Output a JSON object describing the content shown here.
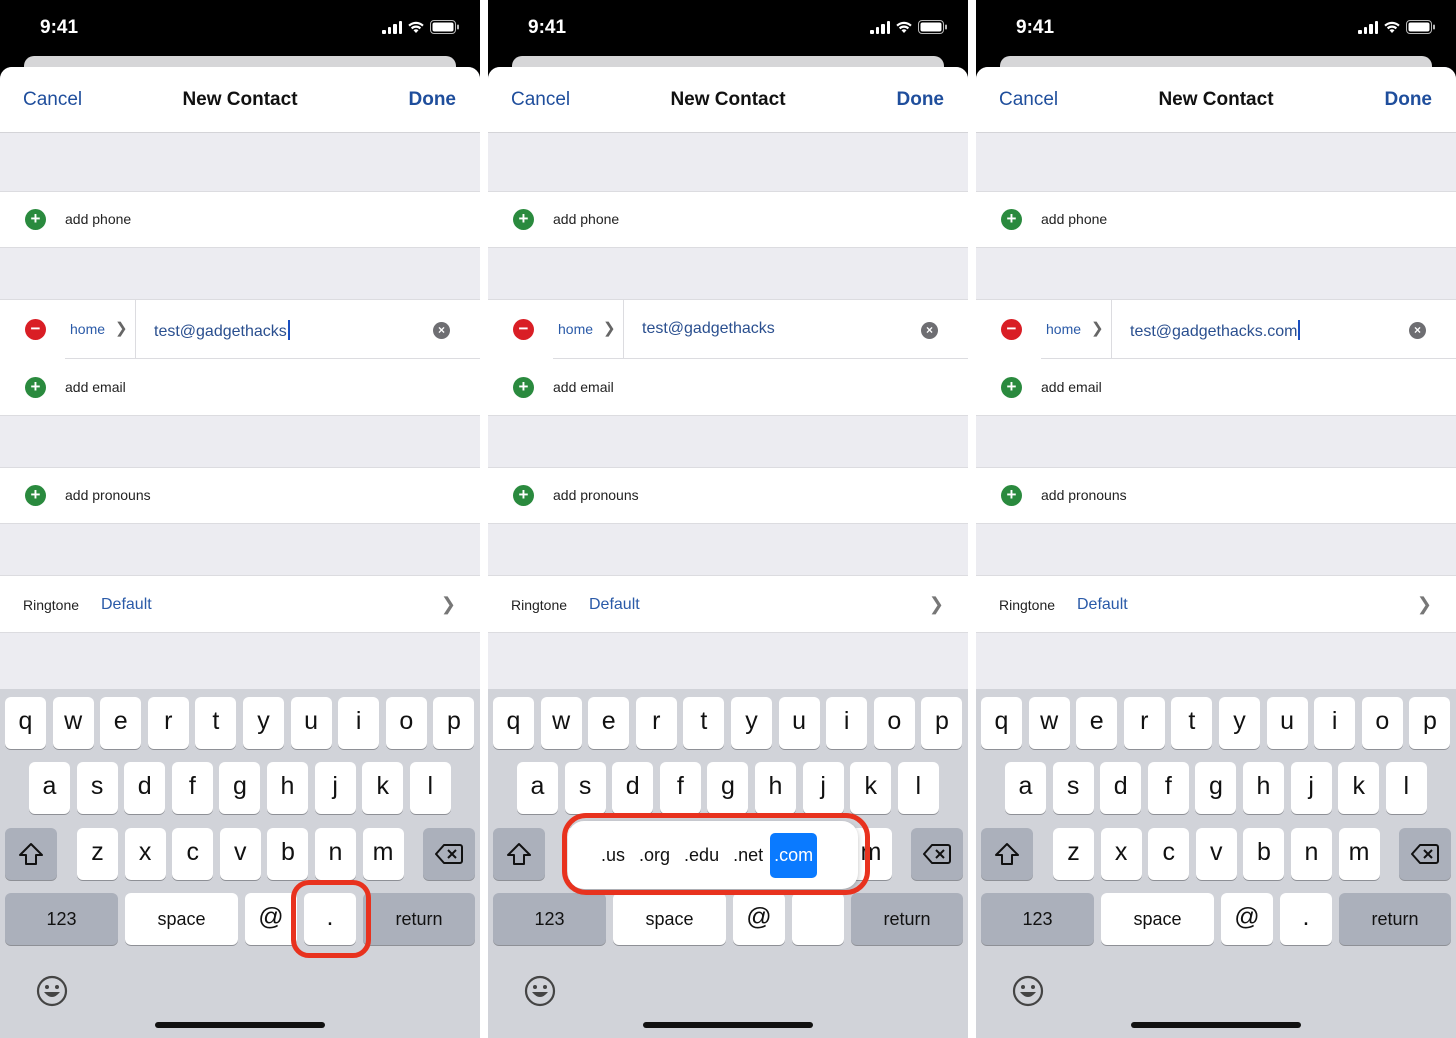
{
  "panels": [
    {
      "status": {
        "time": "9:41"
      },
      "nav": {
        "cancel": "Cancel",
        "title": "New Contact",
        "done": "Done"
      },
      "add_phone": "add phone",
      "email": {
        "type": "home",
        "value": "test@gadgethacks",
        "cursor": true
      },
      "add_email": "add email",
      "add_pronouns": "add pronouns",
      "ringtone": {
        "label": "Ringtone",
        "value": "Default"
      },
      "highlight": "period-key"
    },
    {
      "status": {
        "time": "9:41"
      },
      "nav": {
        "cancel": "Cancel",
        "title": "New Contact",
        "done": "Done"
      },
      "add_phone": "add phone",
      "email": {
        "type": "home",
        "value": "test@gadgethacks",
        "cursor": false
      },
      "add_email": "add email",
      "add_pronouns": "add pronouns",
      "ringtone": {
        "label": "Ringtone",
        "value": "Default"
      },
      "domain_suggestions": [
        ".us",
        ".org",
        ".edu",
        ".net",
        ".com"
      ],
      "selected_suggestion": ".com",
      "highlight": "domain-suggestions"
    },
    {
      "status": {
        "time": "9:41"
      },
      "nav": {
        "cancel": "Cancel",
        "title": "New Contact",
        "done": "Done"
      },
      "add_phone": "add phone",
      "email": {
        "type": "home",
        "value": "test@gadgethacks.com",
        "cursor": true
      },
      "add_email": "add email",
      "add_pronouns": "add pronouns",
      "ringtone": {
        "label": "Ringtone",
        "value": "Default"
      },
      "highlight": null
    }
  ],
  "keyboard": {
    "row1": [
      "q",
      "w",
      "e",
      "r",
      "t",
      "y",
      "u",
      "i",
      "o",
      "p"
    ],
    "row2": [
      "a",
      "s",
      "d",
      "f",
      "g",
      "h",
      "j",
      "k",
      "l"
    ],
    "row3": [
      "z",
      "x",
      "c",
      "v",
      "b",
      "n",
      "m"
    ],
    "numbers": "123",
    "space": "space",
    "at": "@",
    "period": ".",
    "return": "return"
  },
  "colors": {
    "accent": "#1f4e9c",
    "add": "#2a8a3e",
    "remove": "#d91e25",
    "highlight": "#e8321e",
    "suggestion_selected": "#0a7aff"
  }
}
